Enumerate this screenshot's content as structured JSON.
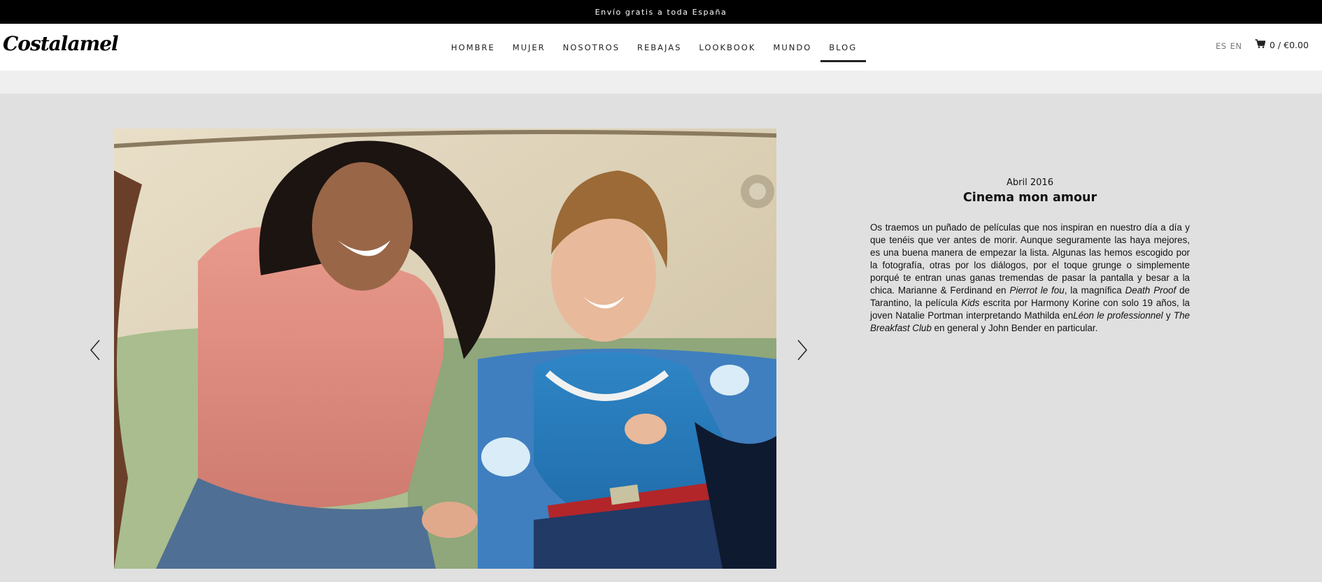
{
  "announcement": "Envío gratis a toda España",
  "brand": {
    "logo_text": "Costalamel"
  },
  "nav": {
    "items": [
      {
        "label": "HOMBRE",
        "active": false
      },
      {
        "label": "MUJER",
        "active": false
      },
      {
        "label": "NOSOTROS",
        "active": false
      },
      {
        "label": "REBAJAS",
        "active": false
      },
      {
        "label": "LOOKBOOK",
        "active": false
      },
      {
        "label": "MUNDO",
        "active": false
      },
      {
        "label": "BLOG",
        "active": true
      }
    ]
  },
  "language": {
    "options": [
      "ES",
      "EN"
    ]
  },
  "cart": {
    "summary": "0 / €0.00",
    "icon": "cart-icon"
  },
  "slider": {
    "prev_icon": "chevron-left-icon",
    "next_icon": "chevron-right-icon"
  },
  "post": {
    "date": "Abril 2016",
    "title": "Cinema mon amour",
    "body": {
      "intro": "Os traemos un puñado de películas que nos inspiran en nuestro día a día y que tenéis que ver antes de morir. Aunque seguramente las haya mejores, es una buena manera de empezar la lista. Algunas las hemos escogido por la fotografía, otras por los diálogos, por el toque grunge o simplemente porqué te entran unas ganas tremendas de pasar la pantalla y besar a la chica. Marianne & Ferdinand en ",
      "film1": "Pierrot le fou",
      "t2": ", la magnífica ",
      "film2": "Death Proof",
      "t3": " de Tarantino, la película ",
      "film3": "Kids",
      "t4": " escrita por Harmony Korine con solo 19 años, la joven Natalie Portman interpretando Mathilda en",
      "film4": "Léon le professionnel",
      "t5": " y ",
      "film5": "The Breakfast Club",
      "t6": " en general y John Bender en particular."
    }
  },
  "colors": {
    "topbar_bg": "#000000",
    "header_bg": "#ffffff",
    "subbar_bg": "#efefef",
    "content_bg": "#e0e0e0",
    "text": "#111111"
  }
}
